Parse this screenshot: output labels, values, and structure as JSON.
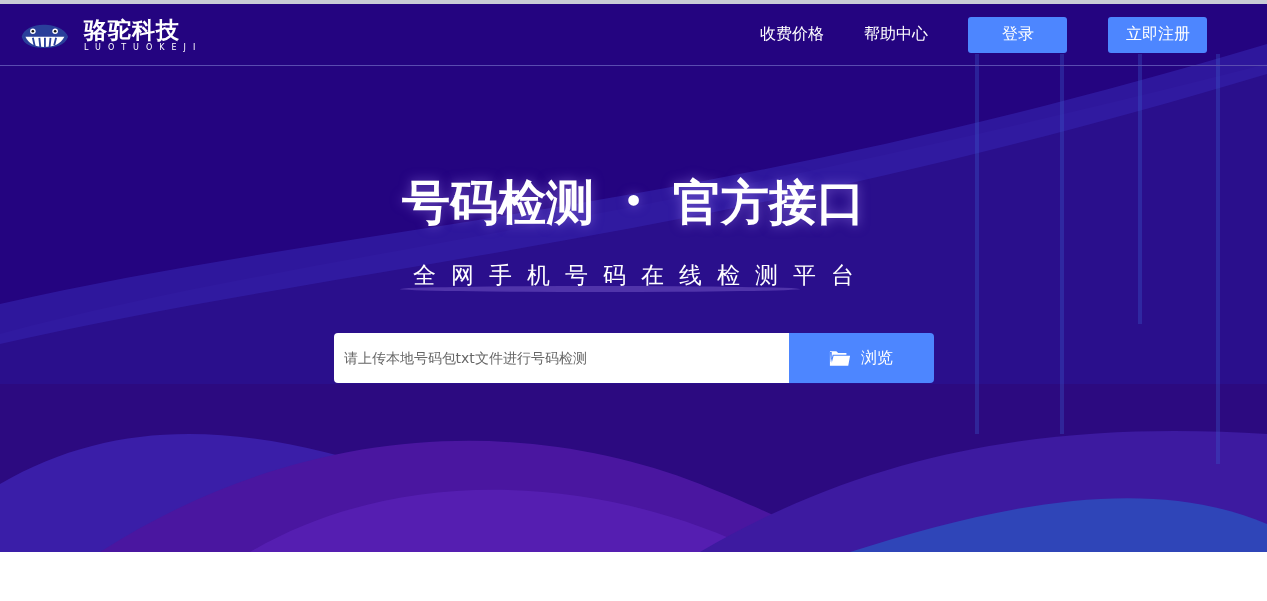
{
  "logo": {
    "name": "骆驼科技",
    "subtitle": "LUOTUOKEJI"
  },
  "nav": [
    "收费价格",
    "帮助中心"
  ],
  "buttons": [
    "登录",
    "立即注册"
  ],
  "hero": {
    "title": "号码检测",
    "separator": "•",
    "title_2": "官方接口",
    "subtitle": "全网手机号码在线检测平台"
  },
  "upload": {
    "placeholder": "请上传本地号码包txt文件进行号码检测",
    "button": "浏览"
  }
}
